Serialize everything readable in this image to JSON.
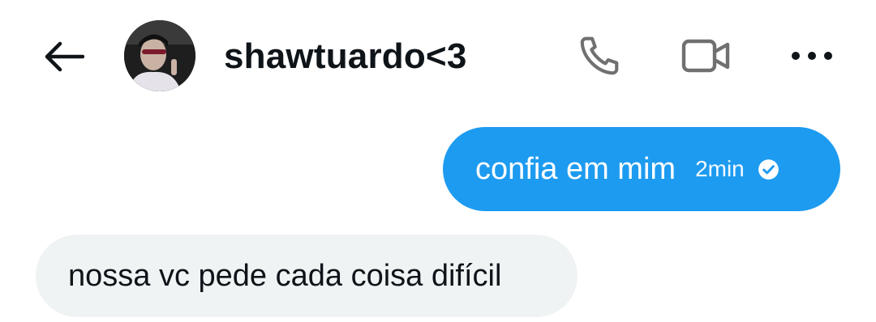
{
  "header": {
    "contact_name": "shawtuardo<3",
    "back_icon": "arrow-left-icon",
    "call_icon": "phone-icon",
    "video_icon": "video-camera-icon",
    "more_icon": "more-dots-icon"
  },
  "messages": [
    {
      "direction": "outgoing",
      "text": "confia em mim",
      "time": "2min",
      "status_icon": "seen-check-icon"
    },
    {
      "direction": "incoming",
      "text": "nossa vc pede cada coisa difícil"
    }
  ],
  "colors": {
    "outgoing_bubble": "#1d9bf0",
    "incoming_bubble": "#eff3f4",
    "text_primary": "#0f1419",
    "icon_gray": "#707070"
  }
}
